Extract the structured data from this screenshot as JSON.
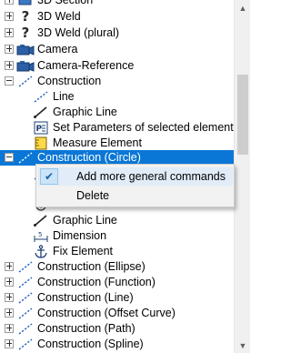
{
  "tree": {
    "items": [
      {
        "label": "3D Section"
      },
      {
        "label": "3D Weld"
      },
      {
        "label": "3D Weld (plural)"
      },
      {
        "label": "Camera"
      },
      {
        "label": "Camera-Reference"
      },
      {
        "label": "Construction"
      },
      {
        "label": "Line"
      },
      {
        "label": "Graphic Line"
      },
      {
        "label": "Set Parameters of selected element"
      },
      {
        "label": "Measure Element"
      },
      {
        "label": "Construction (Circle)"
      },
      {
        "label": "Graphic Line"
      },
      {
        "label": "Dimension"
      },
      {
        "label": "Fix Element"
      },
      {
        "label": "Construction (Ellipse)"
      },
      {
        "label": "Construction (Function)"
      },
      {
        "label": "Construction (Line)"
      },
      {
        "label": "Construction (Offset Curve)"
      },
      {
        "label": "Construction (Path)"
      },
      {
        "label": "Construction (Spline)"
      }
    ],
    "selected_item": "Construction (Circle)"
  },
  "context_menu": {
    "items": [
      {
        "label": "Add more general commands",
        "checked": true
      },
      {
        "label": "Delete",
        "checked": false
      }
    ]
  },
  "icons": {
    "expander_plus": "plus-box-icon",
    "expander_minus": "minus-box-icon",
    "section": "section-icon",
    "weld": "question-mark-icon",
    "camera": "camera-icon",
    "construction": "dashed-line-icon",
    "line": "line-icon",
    "graphic_line": "graphic-line-icon",
    "set_parameters": "parameters-icon",
    "measure": "measure-icon",
    "dimension": "dimension-icon",
    "fix": "anchor-icon"
  },
  "colors": {
    "selection": "#0a77d6",
    "menu_background": "#f2f2f2",
    "menu_hover": "#e1ecf8",
    "checkmark": "#1763a8",
    "dashed_line": "#1f5fbf"
  }
}
